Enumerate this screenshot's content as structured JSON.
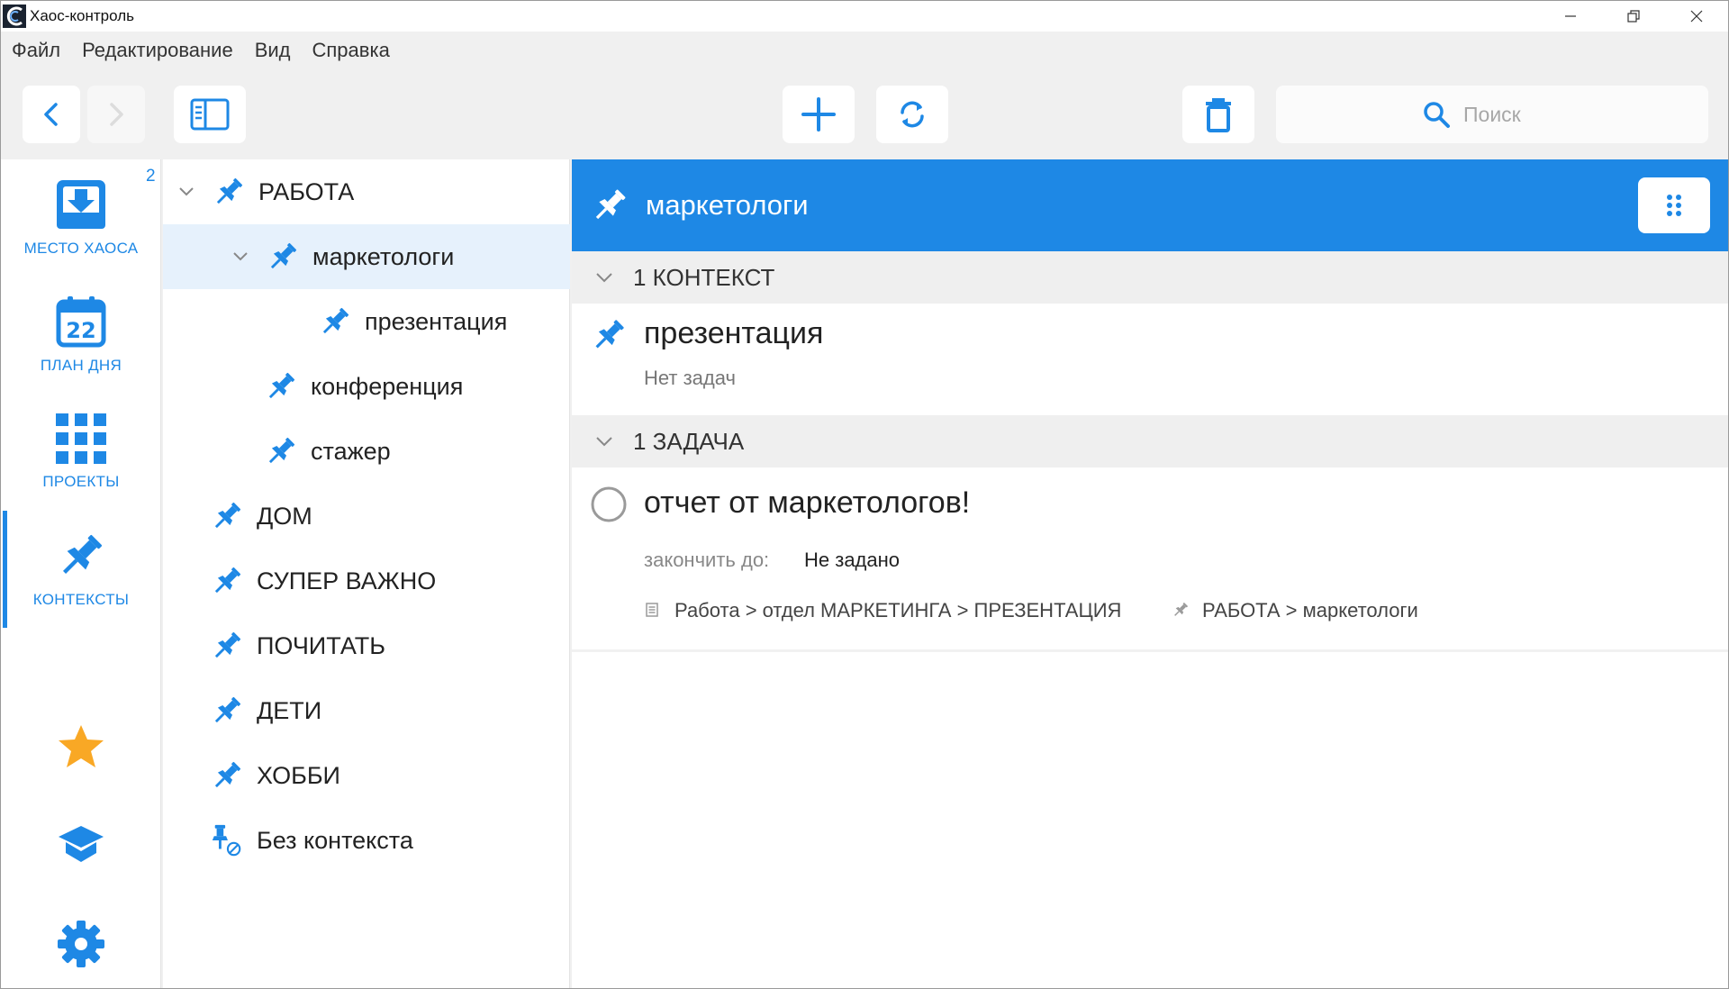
{
  "window": {
    "title": "Хаос-контроль"
  },
  "menu": [
    "Файл",
    "Редактирование",
    "Вид",
    "Справка"
  ],
  "search": {
    "placeholder": "Поиск"
  },
  "nav": {
    "items": [
      {
        "label": "МЕСТО ХАОСА",
        "icon": "inbox-icon"
      },
      {
        "label": "ПЛАН ДНЯ",
        "icon": "calendar-icon",
        "day": "22"
      },
      {
        "label": "ПРОЕКТЫ",
        "icon": "grid-icon"
      },
      {
        "label": "КОНТЕКСТЫ",
        "icon": "pin-icon"
      }
    ],
    "badge": "2",
    "active_index": 3
  },
  "tree": {
    "items": [
      {
        "label": "РАБОТА",
        "level": 0,
        "expanded": true
      },
      {
        "label": "маркетологи",
        "level": 1,
        "expanded": true,
        "selected": true
      },
      {
        "label": "презентация",
        "level": 2
      },
      {
        "label": "конференция",
        "level": 1
      },
      {
        "label": "стажер",
        "level": 1
      },
      {
        "label": "ДОМ",
        "level": 0
      },
      {
        "label": "СУПЕР ВАЖНО",
        "level": 0
      },
      {
        "label": "ПОЧИТАТЬ",
        "level": 0
      },
      {
        "label": "ДЕТИ",
        "level": 0
      },
      {
        "label": "ХОББИ",
        "level": 0
      },
      {
        "label": "Без контекста",
        "level": 0,
        "icon": "no-context-icon"
      }
    ]
  },
  "main": {
    "title": "маркетологи",
    "contexts_section": "1 КОНТЕКСТ",
    "context": {
      "title": "презентация",
      "subtitle": "Нет задач"
    },
    "tasks_section": "1 ЗАДАЧА",
    "task": {
      "title": "отчет от маркетологов!",
      "due_label": "закончить до:",
      "due_value": "Не задано",
      "project_path": "Работа > отдел МАРКЕТИНГА > ПРЕЗЕНТАЦИЯ",
      "context_path": "РАБОТА > маркетологи"
    }
  },
  "colors": {
    "accent": "#1e88e5",
    "star": "#f9a825",
    "selected_row": "#e6f1fc",
    "section_bg": "#efefef"
  }
}
